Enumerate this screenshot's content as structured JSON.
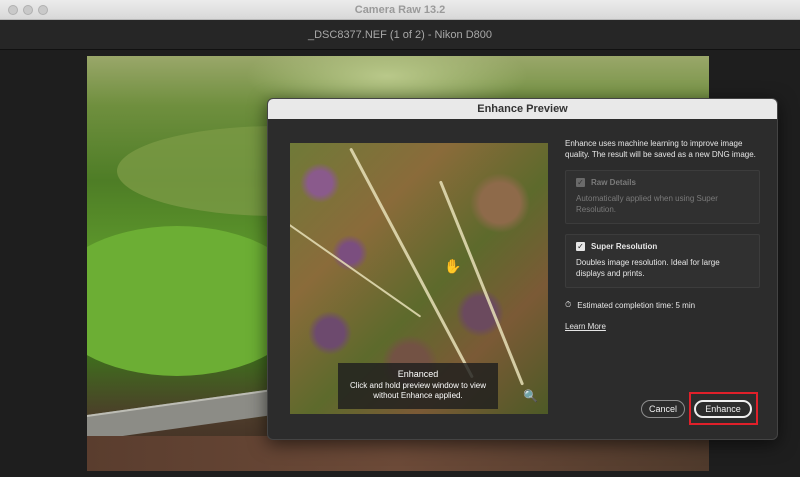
{
  "window": {
    "app_title": "Camera Raw 13.2"
  },
  "header": {
    "file_title": "_DSC8377.NEF (1 of 2)  -  Nikon D800"
  },
  "dialog": {
    "title": "Enhance Preview",
    "intro": "Enhance uses machine learning to improve image quality. The result will be saved as a new DNG image.",
    "options": [
      {
        "label": "Raw Details",
        "description": "Automatically applied when using Super Resolution.",
        "checked": true,
        "disabled": true
      },
      {
        "label": "Super Resolution",
        "description": "Doubles image resolution. Ideal for large displays and prints.",
        "checked": true,
        "disabled": false
      }
    ],
    "estimate": "Estimated completion time: 5 min",
    "learn_more": "Learn More",
    "preview": {
      "overlay_title": "Enhanced",
      "overlay_text": "Click and hold preview window to view without Enhance applied."
    },
    "buttons": {
      "cancel": "Cancel",
      "enhance": "Enhance"
    }
  },
  "icons": {
    "hand": "hand-cursor-icon",
    "zoom": "zoom-out-icon",
    "clock": "stopwatch-icon",
    "check": "checkmark-icon"
  },
  "colors": {
    "highlight": "#e0202a"
  }
}
